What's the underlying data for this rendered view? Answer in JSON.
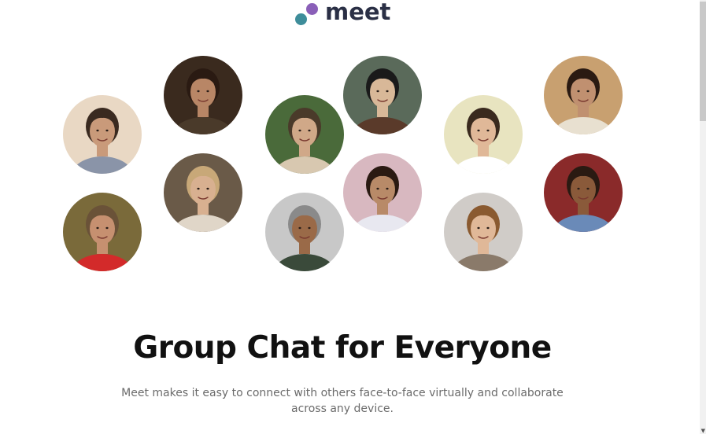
{
  "brand": {
    "name": "meet",
    "colors": {
      "dot_purple": "#8a5fb8",
      "dot_teal": "#3e8d9a",
      "wordmark": "#2a2f45"
    }
  },
  "hero": {
    "avatars": [
      {
        "name": "avatar-young-man-sunset",
        "bg": "#e9d8c4",
        "skin": "#c99a7a",
        "hair": "#3a2a20",
        "shirt": "#8a94a8"
      },
      {
        "name": "avatar-bearded-man-red-shirt",
        "bg": "#7a6a3a",
        "skin": "#c69070",
        "hair": "#6a5238",
        "shirt": "#d32a2a"
      },
      {
        "name": "avatar-smiling-woman-dark-hair",
        "bg": "#3a2a1e",
        "skin": "#b88666",
        "hair": "#2a1a12",
        "shirt": "#4a3a2a"
      },
      {
        "name": "avatar-woman-blonde-hand-on-head",
        "bg": "#6a5a48",
        "skin": "#d8b090",
        "hair": "#c8a878",
        "shirt": "#e0d6c8"
      },
      {
        "name": "avatar-man-glasses-jacket",
        "bg": "#4a6a3a",
        "skin": "#d0a888",
        "hair": "#4a3a2a",
        "shirt": "#d8c8b0"
      },
      {
        "name": "avatar-older-man-smiling",
        "bg": "#c8c8c8",
        "skin": "#9a6a48",
        "hair": "#8a8a8a",
        "shirt": "#3a4a3a"
      },
      {
        "name": "avatar-man-sunglasses",
        "bg": "#5a6a5a",
        "skin": "#d8b898",
        "hair": "#1a1a1a",
        "shirt": "#5a3a2a"
      },
      {
        "name": "avatar-man-flowers-background",
        "bg": "#d8b8c0",
        "skin": "#b88a68",
        "hair": "#2a1a12",
        "shirt": "#e8e8f0"
      },
      {
        "name": "avatar-man-laughing-cream-bg",
        "bg": "#e8e4c0",
        "skin": "#e0b898",
        "hair": "#3a2a1e",
        "shirt": "#ffffff"
      },
      {
        "name": "avatar-young-man-wavy-hair",
        "bg": "#d0ccc8",
        "skin": "#e0b898",
        "hair": "#8a5a30",
        "shirt": "#8a7a6a"
      },
      {
        "name": "avatar-couple-flowers",
        "bg": "#c8a070",
        "skin": "#c09070",
        "hair": "#2a1a12",
        "shirt": "#e8e0d0"
      },
      {
        "name": "avatar-woman-denim-red-wall",
        "bg": "#8a2a2a",
        "skin": "#8a5a3a",
        "hair": "#2a1a12",
        "shirt": "#6a8ab8"
      }
    ]
  },
  "main": {
    "headline": "Group Chat for Everyone",
    "subtext": "Meet makes it easy to connect with others face-to-face virtually and collaborate across any device."
  }
}
